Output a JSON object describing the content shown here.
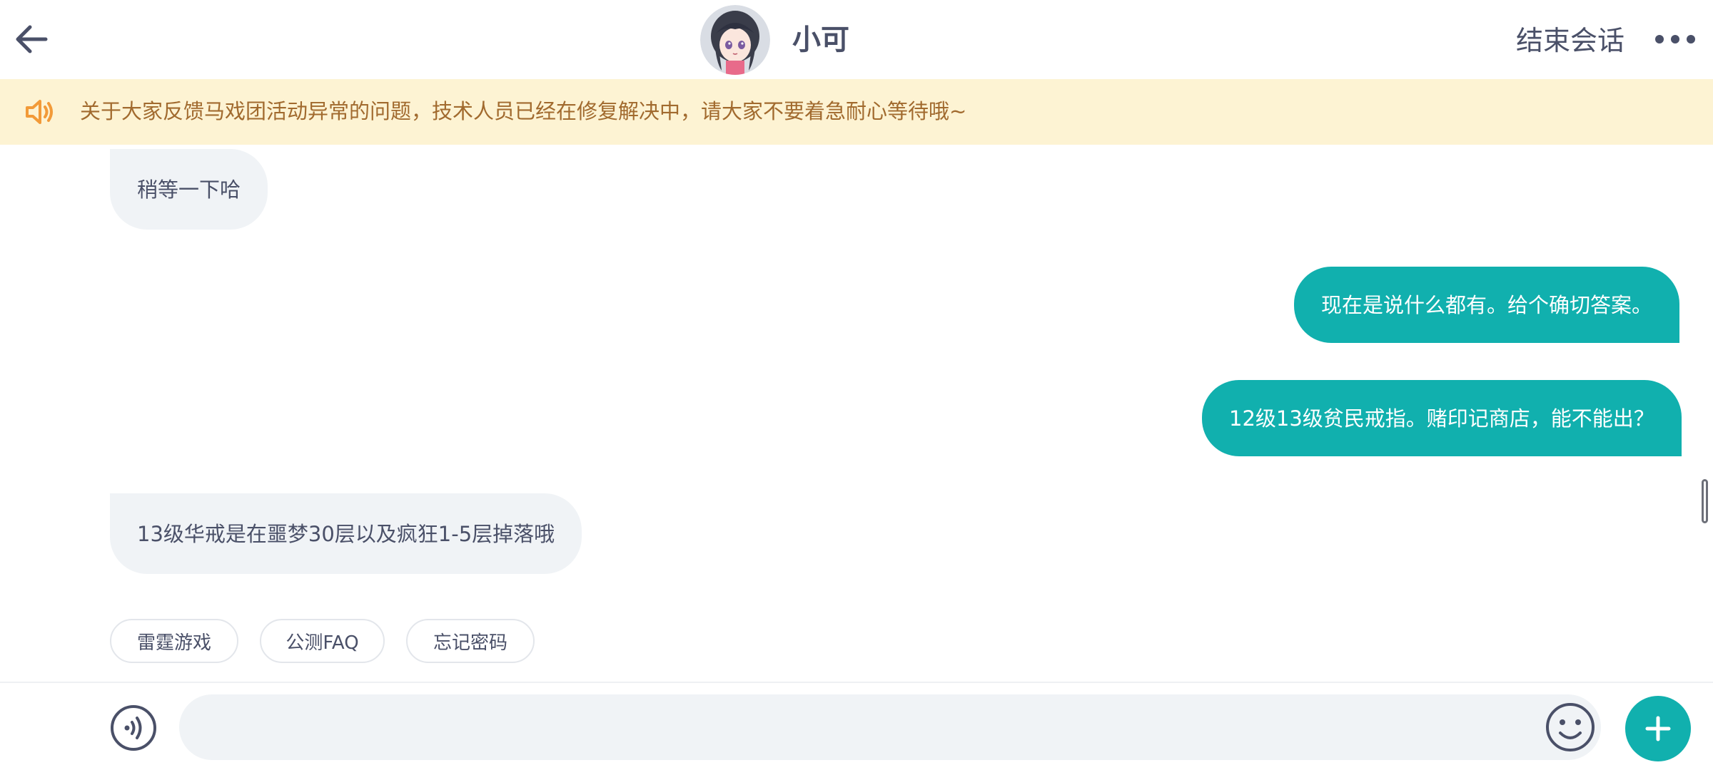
{
  "header": {
    "title": "小可",
    "end_chat_label": "结束会话",
    "back_icon": "arrow-left-icon",
    "more_icon": "more-dots-icon"
  },
  "notice": {
    "icon": "speaker-icon",
    "text": "关于大家反馈马戏团活动异常的问题，技术人员已经在修复解决中，请大家不要着急耐心等待哦~"
  },
  "messages": [
    {
      "side": "in",
      "text": "稍等一下哈"
    },
    {
      "side": "out",
      "text": "现在是说什么都有。给个确切答案。"
    },
    {
      "side": "out",
      "text": "12级13级贫民戒指。赌印记商店，能不能出？"
    },
    {
      "side": "in",
      "text": "13级华戒是在噩梦30层以及疯狂1-5层掉落哦"
    }
  ],
  "quick_replies": [
    "雷霆游戏",
    "公测FAQ",
    "忘记密码"
  ],
  "input": {
    "value": "",
    "placeholder": "",
    "voice_icon": "voice-icon",
    "emoji_icon": "emoji-icon",
    "plus_icon": "plus-icon"
  },
  "colors": {
    "accent": "#11b0ae",
    "notice_bg": "#fdf3d3",
    "notice_text": "#a16a2e",
    "incoming_bubble": "#f0f3f6",
    "text_primary": "#4a5068",
    "speaker_icon": "#f29a38"
  }
}
